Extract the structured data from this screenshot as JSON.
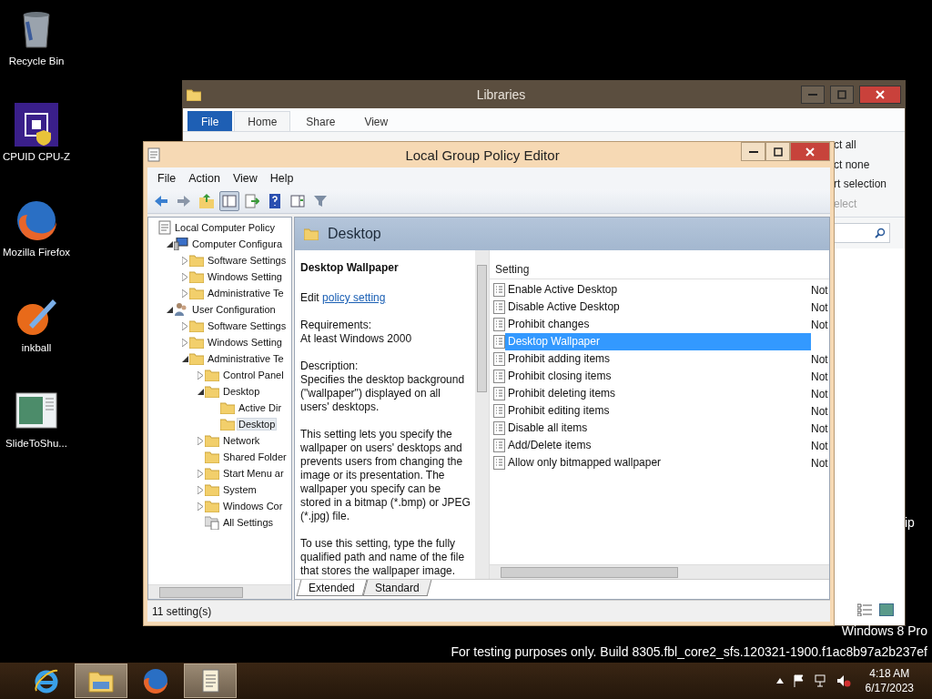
{
  "desktop_icons": [
    {
      "kind": "recycle",
      "label": "Recycle Bin"
    },
    {
      "kind": "chip",
      "label": "CPUID CPU-Z"
    },
    {
      "kind": "firefox",
      "label": "Mozilla Firefox"
    },
    {
      "kind": "inkball",
      "label": "inkball"
    },
    {
      "kind": "slide",
      "label": "SlideToShu..."
    }
  ],
  "desktop_label_fragment": "ip",
  "libraries": {
    "title": "Libraries",
    "tabs": [
      {
        "label": "File",
        "kind": "file",
        "selected": false
      },
      {
        "label": "Home",
        "kind": "tab",
        "selected": true
      },
      {
        "label": "Share",
        "kind": "tab",
        "selected": false
      },
      {
        "label": "View",
        "kind": "tab",
        "selected": false
      }
    ],
    "select_items": [
      {
        "label": "ct all",
        "disabled": false
      },
      {
        "label": "ct none",
        "disabled": false
      },
      {
        "label": "rt selection",
        "disabled": false
      },
      {
        "label": "elect",
        "disabled": true
      }
    ]
  },
  "gpedit": {
    "title": "Local Group Policy Editor",
    "menu": [
      "File",
      "Action",
      "View",
      "Help"
    ],
    "toolbar": [
      {
        "kind": "back",
        "pressed": false
      },
      {
        "kind": "forward",
        "pressed": false
      },
      {
        "kind": "up",
        "pressed": false
      },
      {
        "kind": "tree",
        "pressed": true
      },
      {
        "kind": "export",
        "pressed": false
      },
      {
        "kind": "help",
        "pressed": false
      },
      {
        "kind": "pane",
        "pressed": false
      },
      {
        "kind": "filter",
        "pressed": false
      }
    ],
    "tree": [
      {
        "label": "Local Computer Policy",
        "kind": "root",
        "selected": false,
        "children": [
          {
            "label": "Computer Configura",
            "kind": "computer",
            "expanded": true,
            "selected": false,
            "children": [
              {
                "label": "Software Settings",
                "kind": "folder",
                "expanded": false,
                "selected": false
              },
              {
                "label": "Windows Setting",
                "kind": "folder",
                "expanded": false,
                "selected": false
              },
              {
                "label": "Administrative Te",
                "kind": "folder",
                "expanded": false,
                "selected": false
              }
            ]
          },
          {
            "label": "User Configuration",
            "kind": "user",
            "expanded": true,
            "selected": false,
            "children": [
              {
                "label": "Software Settings",
                "kind": "folder",
                "expanded": false,
                "selected": false
              },
              {
                "label": "Windows Setting",
                "kind": "folder",
                "expanded": false,
                "selected": false
              },
              {
                "label": "Administrative Te",
                "kind": "folder",
                "expanded": true,
                "selected": false,
                "children": [
                  {
                    "label": "Control Panel",
                    "kind": "folder",
                    "expanded": false,
                    "selected": false
                  },
                  {
                    "label": "Desktop",
                    "kind": "folder",
                    "expanded": true,
                    "selected": false,
                    "children": [
                      {
                        "label": "Active Dir",
                        "kind": "folder",
                        "selected": false
                      },
                      {
                        "label": "Desktop",
                        "kind": "folder",
                        "selected": true
                      }
                    ]
                  },
                  {
                    "label": "Network",
                    "kind": "folder",
                    "expanded": false,
                    "selected": false
                  },
                  {
                    "label": "Shared Folder",
                    "kind": "folder",
                    "selected": false
                  },
                  {
                    "label": "Start Menu ar",
                    "kind": "folder",
                    "expanded": false,
                    "selected": false
                  },
                  {
                    "label": "System",
                    "kind": "folder",
                    "expanded": false,
                    "selected": false
                  },
                  {
                    "label": "Windows Cor",
                    "kind": "folder",
                    "expanded": false,
                    "selected": false
                  },
                  {
                    "label": "All Settings",
                    "kind": "all",
                    "selected": false
                  }
                ]
              }
            ]
          }
        ]
      }
    ],
    "header": "Desktop",
    "description": {
      "title": "Desktop Wallpaper",
      "edit_prefix": "Edit",
      "edit_link": "policy setting",
      "paragraphs": [
        "Requirements:\nAt least Windows 2000",
        "Description:\nSpecifies the desktop background (\"wallpaper\") displayed on all users' desktops.",
        "This setting lets you specify the wallpaper on users' desktops and prevents users from changing the image or its presentation. The wallpaper you specify can be stored in a bitmap (*.bmp) or JPEG (*.jpg) file.",
        "To use this setting, type the fully qualified path and name of the file that stores the wallpaper image."
      ]
    },
    "columns": [
      "Setting"
    ],
    "settings": [
      {
        "name": "Enable Active Desktop",
        "state": "Not",
        "selected": false
      },
      {
        "name": "Disable Active Desktop",
        "state": "Not",
        "selected": false
      },
      {
        "name": "Prohibit changes",
        "state": "Not",
        "selected": false
      },
      {
        "name": "Desktop Wallpaper",
        "selected": true
      },
      {
        "name": "Prohibit adding items",
        "state": "Not",
        "selected": false
      },
      {
        "name": "Prohibit closing items",
        "state": "Not",
        "selected": false
      },
      {
        "name": "Prohibit deleting items",
        "state": "Not",
        "selected": false
      },
      {
        "name": "Prohibit editing items",
        "state": "Not",
        "selected": false
      },
      {
        "name": "Disable all items",
        "state": "Not",
        "selected": false
      },
      {
        "name": "Add/Delete items",
        "state": "Not",
        "selected": false
      },
      {
        "name": "Allow only bitmapped wallpaper",
        "state": "Not",
        "selected": false
      }
    ],
    "view_tabs": [
      {
        "label": "Extended",
        "selected": true
      },
      {
        "label": "Standard",
        "selected": false
      }
    ],
    "status": "11 setting(s)"
  },
  "watermark": [
    "Windows 8 Pro",
    "For testing purposes only. Build 8305.fbl_core2_sfs.120321-1900.f1ac8b97a2b237ef"
  ],
  "taskbar": {
    "apps": [
      {
        "kind": "ie",
        "active": false
      },
      {
        "kind": "explorer",
        "active": true
      },
      {
        "kind": "firefox",
        "active": false
      },
      {
        "kind": "gpedit",
        "active": true
      }
    ],
    "time": "4:18 AM",
    "date": "6/17/2023"
  }
}
